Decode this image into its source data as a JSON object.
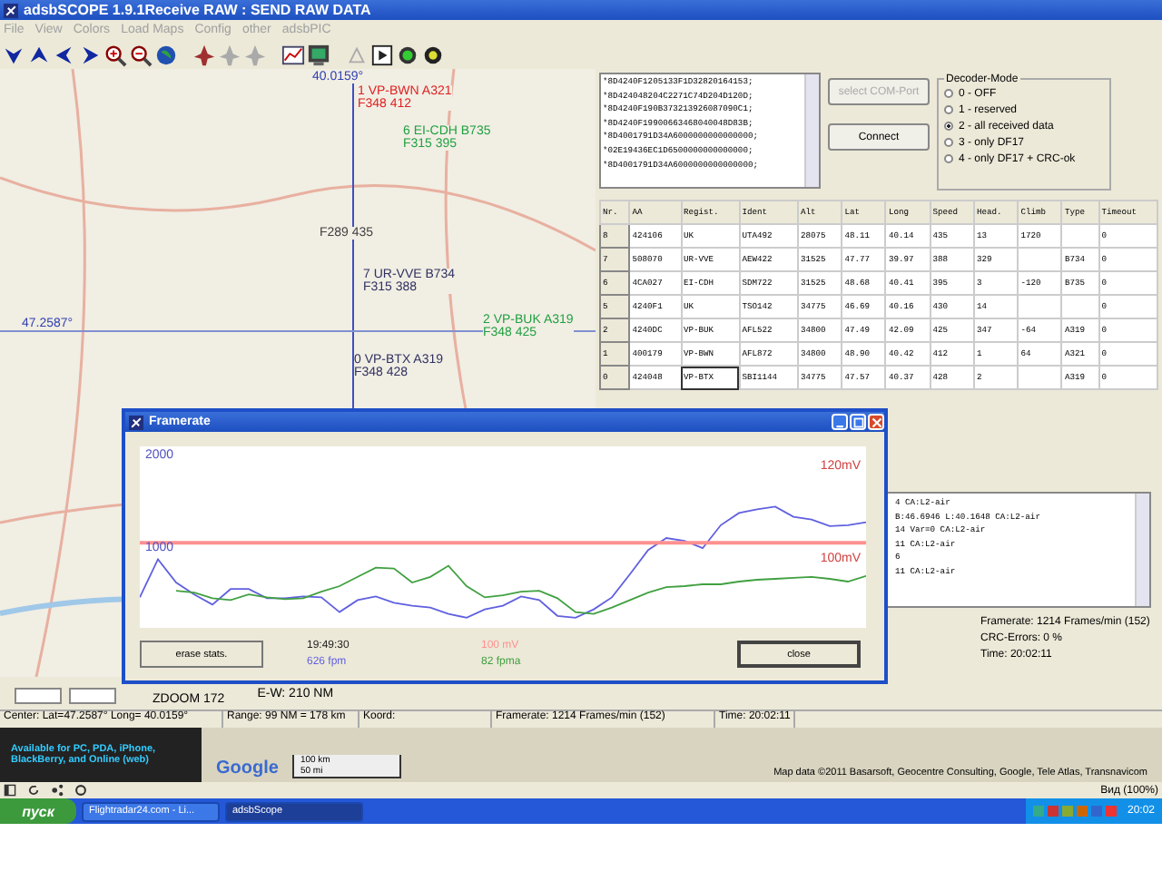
{
  "window": {
    "title": "adsbSCOPE 1.9.1Receive RAW : SEND RAW DATA"
  },
  "menu": [
    "File",
    "View",
    "Colors",
    "Load Maps",
    "Config",
    "other",
    "adsbPIC"
  ],
  "map": {
    "center_long": "40.0159°",
    "center_lat": "47.2587°",
    "zoom": "ZDOOM 172",
    "range_ew": "E-W: 210 NM",
    "aircraft": [
      {
        "line1": "1  VP-BWN  A321",
        "line2": "F348 412",
        "color": "#e02020"
      },
      {
        "line1": "6  EI-CDH  B735",
        "line2": "F315 395",
        "color": "#20a040"
      },
      {
        "line2": "F289 435",
        "color": "#404040"
      },
      {
        "line1": "7  UR-VVE  B734",
        "line2": "F315 388",
        "color": "#303060"
      },
      {
        "line1": "0  VP-BTX  A319",
        "line2": "F348 428",
        "color": "#303060"
      },
      {
        "line1": "2  VP-BUK  A319",
        "line2": "F348 425",
        "color": "#20a040"
      }
    ]
  },
  "raw_data": [
    "*8D4240F1205133F1D32820164153;",
    "*8D424048204C2271C74D204D120D;",
    "*8D4240F190B373213926087090C1;",
    "*8D4240F19900663468040048D83B;",
    "*8D4001791D34A6000000000000000;",
    "*02E19436EC1D6500000000000000;",
    "*8D4001791D34A6000000000000000;"
  ],
  "com_port_button": {
    "label": "select COM-Port",
    "disabled": true
  },
  "connect_button": {
    "label": "Connect",
    "disabled": false
  },
  "decoder_mode": {
    "title": "Decoder-Mode",
    "options": [
      {
        "label": "0 - OFF",
        "selected": false
      },
      {
        "label": "1 - reserved",
        "selected": false
      },
      {
        "label": "2 - all received data",
        "selected": true
      },
      {
        "label": "3 - only DF17",
        "selected": false
      },
      {
        "label": "4 - only DF17 + CRC-ok",
        "selected": false
      }
    ]
  },
  "table": {
    "columns": [
      "Nr.",
      "AA",
      "Regist.",
      "Ident",
      "Alt",
      "Lat",
      "Long",
      "Speed",
      "Head.",
      "Climb",
      "Type",
      "Timeout"
    ],
    "rows": [
      {
        "cells": [
          "8",
          "424106",
          "UK",
          "UTA492",
          "28075",
          "48.11",
          "40.14",
          "435",
          "13",
          "1720",
          "",
          "0"
        ],
        "selected": false
      },
      {
        "cells": [
          "7",
          "508070",
          "UR-VVE",
          "AEW422",
          "31525",
          "47.77",
          "39.97",
          "388",
          "329",
          "",
          "B734",
          "0"
        ],
        "selected": false
      },
      {
        "cells": [
          "6",
          "4CA027",
          "EI-CDH",
          "SDM722",
          "31525",
          "48.68",
          "40.41",
          "395",
          "3",
          "-120",
          "B735",
          "0"
        ],
        "selected": false
      },
      {
        "cells": [
          "5",
          "4240F1",
          "UK",
          "TSO142",
          "34775",
          "46.69",
          "40.16",
          "430",
          "14",
          "",
          "",
          "0"
        ],
        "selected": false
      },
      {
        "cells": [
          "2",
          "4240DC",
          "VP-BUK",
          "AFL522",
          "34800",
          "47.49",
          "42.09",
          "425",
          "347",
          "-64",
          "A319",
          "0"
        ],
        "selected": false
      },
      {
        "cells": [
          "1",
          "400179",
          "VP-BWN",
          "AFL872",
          "34800",
          "48.90",
          "40.42",
          "412",
          "1",
          "64",
          "A321",
          "0"
        ],
        "selected": false
      },
      {
        "cells": [
          "0",
          "424048",
          "VP-BTX",
          "SBI1144",
          "34775",
          "47.57",
          "40.37",
          "428",
          "2",
          "",
          "A319",
          "0"
        ],
        "selected": true
      }
    ]
  },
  "log": [
    "4   CA:L2-air",
    "B:46.6946  L:40.1648  CA:L2-air",
    "14 Var=0  CA:L2-air",
    "11  CA:L2-air",
    "6",
    "11  CA:L2-air"
  ],
  "stats": [
    "Framerate:  1214 Frames/min (152)",
    "CRC-Errors: 0 %",
    "Time: 20:02:11"
  ],
  "framerate_dialog": {
    "title": "Framerate",
    "right_ticks": [
      "120mV",
      "100mV"
    ],
    "time": "19:49:30",
    "erase_button": "erase stats.",
    "close_button": "close",
    "chart_data": {
      "type": "line",
      "ylim": [
        140,
        2100
      ],
      "yticks": [
        1000,
        2000
      ],
      "series": [
        {
          "name": "626 fpm",
          "color": "#6060e0",
          "values": [
            470,
            880,
            630,
            500,
            390,
            560,
            560,
            460,
            460,
            480,
            470,
            310,
            440,
            480,
            410,
            380,
            360,
            290,
            250,
            340,
            380,
            480,
            440,
            270,
            250,
            340,
            470,
            720,
            980,
            1110,
            1080,
            1000,
            1250,
            1380,
            1420,
            1450,
            1340,
            1310,
            1240,
            1250,
            1280
          ]
        },
        {
          "name": "100 mV",
          "color": "#ff9090",
          "values": [
            1060,
            1060,
            1060,
            1060,
            1060,
            1060,
            1060,
            1060,
            1060,
            1060,
            1060,
            1060,
            1060,
            1060,
            1060,
            1060,
            1060,
            1060,
            1060,
            1060,
            1060,
            1060,
            1060,
            1060,
            1060,
            1060,
            1060,
            1060,
            1060,
            1060,
            1060,
            1060,
            1060,
            1060,
            1060,
            1060,
            1060,
            1060,
            1060,
            1060,
            1060
          ]
        },
        {
          "name": "82 fpma",
          "color": "#40a040",
          "values": [
            null,
            null,
            540,
            520,
            460,
            440,
            500,
            470,
            450,
            460,
            530,
            590,
            690,
            790,
            780,
            630,
            690,
            810,
            590,
            470,
            490,
            530,
            540,
            460,
            310,
            290,
            360,
            440,
            520,
            580,
            590,
            610,
            610,
            640,
            660,
            670,
            680,
            690,
            670,
            640,
            700
          ]
        }
      ]
    }
  },
  "status_bar": [
    "Center: Lat=47.2587° Long= 40.0159°",
    "Range: 99 NM = 178 km",
    "Koord:",
    "Framerate:  1214 Frames/min (152)",
    "Time: 20:02:11"
  ],
  "browser": {
    "banner": "Available for PC, PDA, iPhone, BlackBerry, and Online (web)",
    "map_logo": "Google",
    "scale": [
      "100 km",
      "50 mi"
    ],
    "attribution": "Map data ©2011 Basarsoft, Geocentre Consulting, Google, Tele Atlas, Transnavicom",
    "zoom": "Вид (100%)"
  },
  "taskbar": {
    "start": "пуск",
    "tasks": [
      {
        "label": "Flightradar24.com - Li...",
        "selected": false
      },
      {
        "label": "adsbScope",
        "selected": true
      }
    ],
    "clock": "20:02"
  }
}
